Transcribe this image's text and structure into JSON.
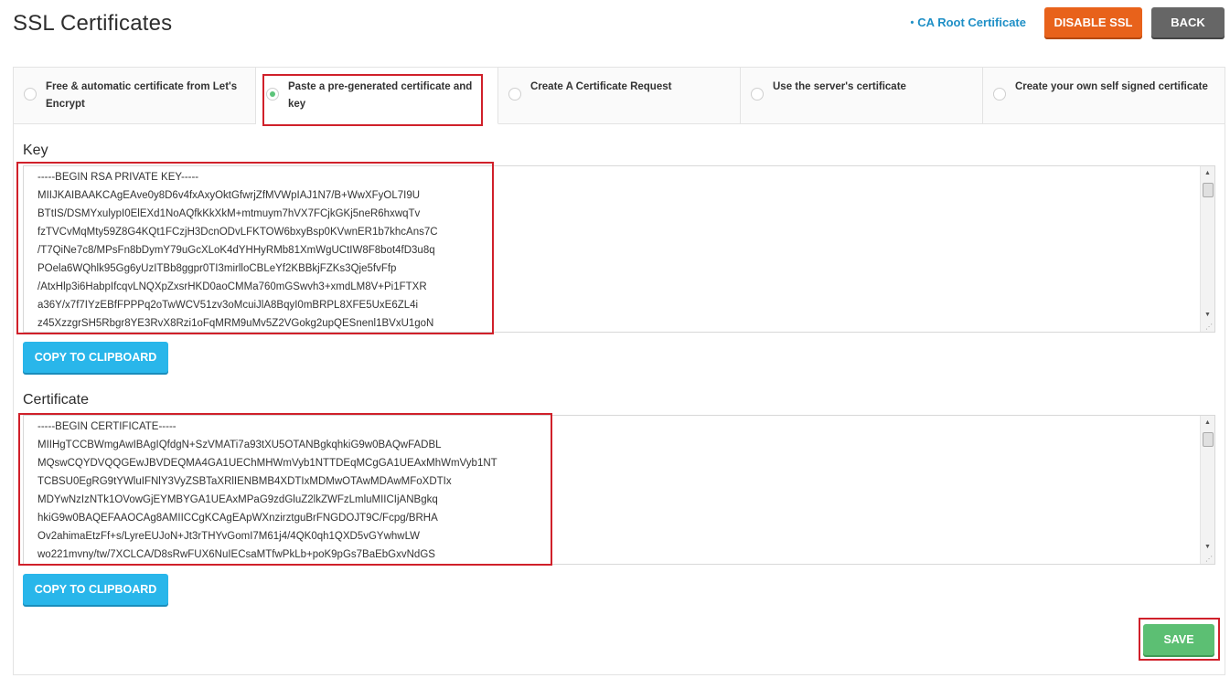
{
  "page": {
    "title": "SSL Certificates"
  },
  "header": {
    "ca_root_label": "CA Root Certificate",
    "disable_ssl_label": "DISABLE SSL",
    "back_label": "BACK"
  },
  "tabs": [
    {
      "label": "Free & automatic certificate from Let's Encrypt",
      "selected": false
    },
    {
      "label": "Paste a pre-generated certificate and key",
      "selected": true
    },
    {
      "label": "Create A Certificate Request",
      "selected": false
    },
    {
      "label": "Use the server's certificate",
      "selected": false
    },
    {
      "label": "Create your own self signed certificate",
      "selected": false
    }
  ],
  "key_section": {
    "label": "Key",
    "lines": [
      "-----BEGIN RSA PRIVATE KEY-----",
      "MIIJKAIBAAKCAgEAve0y8D6v4fxAxyOktGfwrjZfMVWpIAJ1N7/B+WwXFyOL7I9U",
      "BTtIS/DSMYxulypI0ElEXd1NoAQfkKkXkM+mtmuym7hVX7FCjkGKj5neR6hxwqTv",
      "fzTVCvMqMty59Z8G4KQt1FCzjH3DcnODvLFKTOW6bxyBsp0KVwnER1b7khcAns7C",
      "/T7QiNe7c8/MPsFn8bDymY79uGcXLoK4dYHHyRMb81XmWgUCtIW8F8bot4fD3u8q",
      "POela6WQhlk95Gg6yUzITBb8ggpr0TI3mirlloCBLeYf2KBBkjFZKs3Qje5fvFfp",
      "/AtxHlp3i6HabpIfcqvLNQXpZxsrHKD0aoCMMa760mGSwvh3+xmdLM8V+Pi1FTXR",
      "a36Y/x7f7IYzEBfFPPPq2oTwWCV51zv3oMcuiJlA8BqyI0mBRPL8XFE5UxE6ZL4i",
      "z45XzzgrSH5Rbgr8YE3RvX8Rzi1oFqMRM9uMv5Z2VGokg2upQESnenl1BVxU1goN"
    ],
    "copy_label": "COPY TO CLIPBOARD"
  },
  "certificate_section": {
    "label": "Certificate",
    "lines": [
      "-----BEGIN CERTIFICATE-----",
      "MIIHgTCCBWmgAwIBAgIQfdgN+SzVMATi7a93tXU5OTANBgkqhkiG9w0BAQwFADBL",
      "MQswCQYDVQQGEwJBVDEQMA4GA1UEChMHWmVyb1NTTDEqMCgGA1UEAxMhWmVyb1NT",
      "TCBSU0EgRG9tYWluIFNlY3VyZSBTaXRlIENBMB4XDTIxMDMwOTAwMDAwMFoXDTIx",
      "MDYwNzIzNTk1OVowGjEYMBYGA1UEAxMPaG9zdGluZ2lkZWFzLmluMIICIjANBgkq",
      "hkiG9w0BAQEFAAOCAg8AMIICCgKCAgEApWXnzirztguBrFNGDOJT9C/Fcpg/BRHA",
      "Ov2ahimaEtzFf+s/LyreEUJoN+Jt3rTHYvGomI7M61j4/4QK0qh1QXD5vGYwhwLW",
      "wo221mvny/tw/7XCLCA/D8sRwFUX6NuIECsaMTfwPkLb+poK9pGs7BaEbGxvNdGS"
    ],
    "copy_label": "COPY TO CLIPBOARD"
  },
  "footer": {
    "save_label": "SAVE"
  },
  "colors": {
    "disable_ssl": "#e8621b",
    "back": "#666666",
    "copy": "#29b6ea",
    "save": "#5cbf73",
    "link": "#1e8fc6",
    "highlight": "#d0202a",
    "radio_selected": "#5cc47a"
  }
}
